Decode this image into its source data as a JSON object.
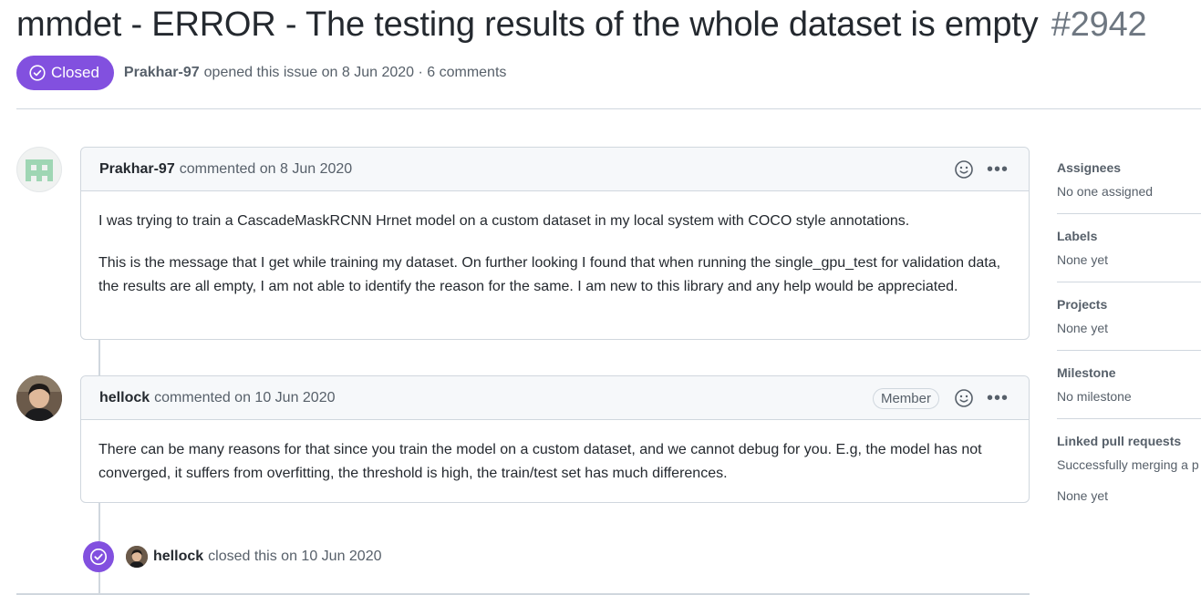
{
  "issue": {
    "title": "mmdet - ERROR - The testing results of the whole dataset is empty",
    "number": "#2942",
    "state": "Closed",
    "author": "Prakhar-97",
    "meta_text": "opened this issue on 8 Jun 2020 · 6 comments"
  },
  "comments": [
    {
      "author": "Prakhar-97",
      "meta": "commented on 8 Jun 2020",
      "body": [
        "I was trying to train a CascadeMaskRCNN Hrnet model on a custom dataset in my local system with COCO style annotations.",
        "This is the message that I get while training my dataset. On further looking I found that when running the single_gpu_test for validation data, the results are all empty, I am not able to identify the reason for the same. I am new to this library and any help would be appreciated."
      ]
    },
    {
      "author": "hellock",
      "meta": "commented on 10 Jun 2020",
      "role": "Member",
      "body": [
        "There can be many reasons for that since you train the model on a custom dataset, and we cannot debug for you. E.g, the model has not converged, it suffers from overfitting, the threshold is high, the train/test set has much differences."
      ]
    }
  ],
  "event": {
    "actor": "hellock",
    "text": "closed this on 10 Jun 2020"
  },
  "sidebar": [
    {
      "title": "Assignees",
      "values": [
        "No one assigned"
      ]
    },
    {
      "title": "Labels",
      "values": [
        "None yet"
      ]
    },
    {
      "title": "Projects",
      "values": [
        "None yet"
      ]
    },
    {
      "title": "Milestone",
      "values": [
        "No milestone"
      ]
    },
    {
      "title": "Linked pull requests",
      "values": [
        "Successfully merging a p",
        "None yet"
      ]
    }
  ],
  "colors": {
    "closed_purple": "#8250df",
    "border": "#d0d7de",
    "muted_text": "#57606a"
  }
}
